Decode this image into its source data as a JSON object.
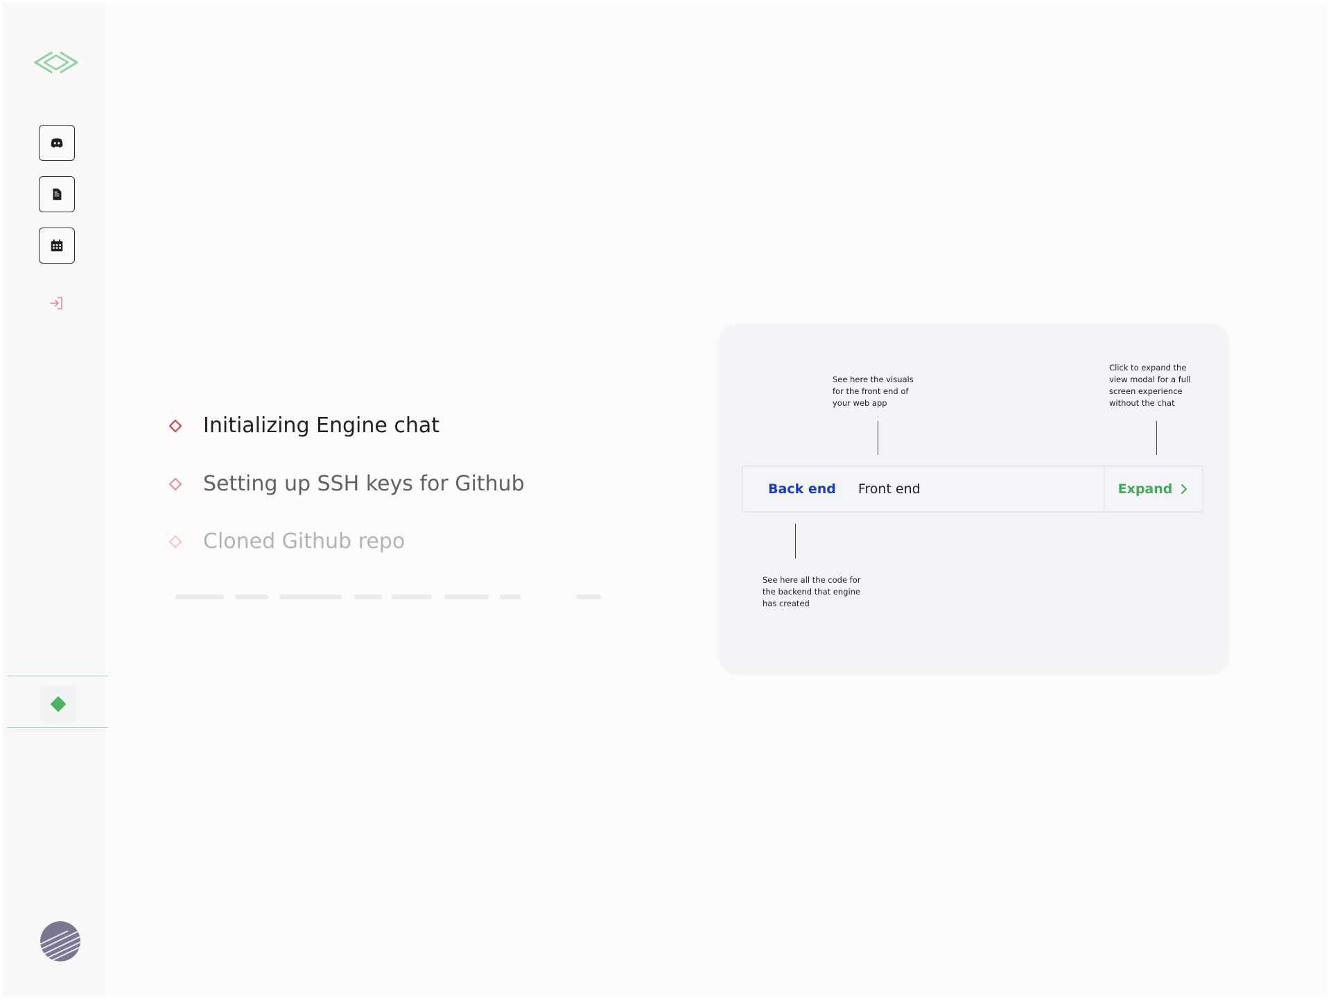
{
  "sidebar": {
    "logo": "engine-logo-icon",
    "buttons": [
      {
        "name": "discord",
        "icon": "discord-icon"
      },
      {
        "name": "document",
        "icon": "document-icon"
      },
      {
        "name": "calendar",
        "icon": "calendar-icon"
      }
    ],
    "logout_icon": "login-arrow-icon",
    "status_icon": "green-diamond-icon",
    "avatar": "user-avatar"
  },
  "steps": [
    {
      "label": "Initializing Engine chat",
      "state": "active"
    },
    {
      "label": "Setting up SSH keys for Github",
      "state": "pending"
    },
    {
      "label": "Cloned Github repo",
      "state": "pending-faded"
    }
  ],
  "card": {
    "note_frontend": "See here the visuals\nfor the front end of\nyour web app",
    "note_expand": "Click to expand the\nview modal for a full\nscreen experience\nwithout the chat",
    "note_backend": "See here all the code for\nthe backend that engine\nhas created",
    "tabs": {
      "back_end": "Back end",
      "front_end": "Front end",
      "expand": "Expand"
    }
  },
  "colors": {
    "accent_green": "#45a85a",
    "accent_blue": "#1a3bc4",
    "danger_red": "#e0383e",
    "sidebar_bg": "#f8f8f9",
    "card_bg": "#f3f4f7"
  }
}
